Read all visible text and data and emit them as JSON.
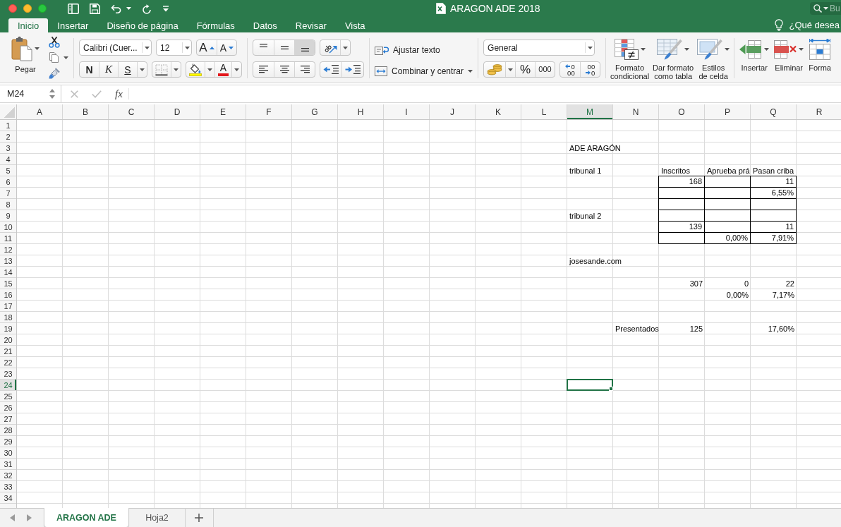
{
  "window": {
    "title": "ARAGON ADE 2018"
  },
  "search": {
    "placeholder": "Bu"
  },
  "ribbon_tabs": [
    {
      "label": "Inicio",
      "selected": true
    },
    {
      "label": "Insertar",
      "selected": false
    },
    {
      "label": "Diseño de página",
      "selected": false
    },
    {
      "label": "Fórmulas",
      "selected": false
    },
    {
      "label": "Datos",
      "selected": false
    },
    {
      "label": "Revisar",
      "selected": false
    },
    {
      "label": "Vista",
      "selected": false
    }
  ],
  "tell_me": {
    "placeholder": "¿Qué desea"
  },
  "ribbon": {
    "paste": {
      "label": "Pegar"
    },
    "font": {
      "name": "Calibri (Cuer...",
      "size": "12"
    },
    "font_size_buttons": [
      {
        "kind": "grow",
        "label": "A"
      },
      {
        "kind": "shrink",
        "label": "A"
      }
    ],
    "font_style_buttons": [
      {
        "kind": "bold",
        "label": "N"
      },
      {
        "kind": "italic",
        "label": "K"
      },
      {
        "kind": "underline",
        "label": "S"
      }
    ],
    "font_color": {
      "label": "A"
    },
    "vertical_align": [
      {
        "kind": "top",
        "selected": false
      },
      {
        "kind": "middle",
        "selected": false
      },
      {
        "kind": "bottom",
        "selected": true
      }
    ],
    "horizontal_align": [
      {
        "kind": "left",
        "selected": false
      },
      {
        "kind": "center",
        "selected": false
      },
      {
        "kind": "right",
        "selected": false
      }
    ],
    "wrap_text": {
      "label": "Ajustar texto"
    },
    "merge": {
      "label": "Combinar y centrar"
    },
    "number_format": {
      "value": "General"
    },
    "number_buttons": [
      {
        "kind": "percent",
        "label": "%"
      },
      {
        "kind": "thousands",
        "label": "000"
      }
    ],
    "decimal_buttons": [
      {
        "kind": "increase",
        "lines": [
          "0",
          "00"
        ]
      },
      {
        "kind": "decrease",
        "lines": [
          "00",
          "0"
        ]
      }
    ],
    "style_buttons": [
      {
        "kind": "conditional",
        "label": "Formato\ncondicional"
      },
      {
        "kind": "table",
        "label": "Dar formato\ncomo tabla"
      },
      {
        "kind": "cell_styles",
        "label": "Estilos\nde celda"
      }
    ],
    "cell_buttons": [
      {
        "kind": "insert",
        "label": "Insertar"
      },
      {
        "kind": "delete",
        "label": "Eliminar"
      },
      {
        "kind": "format",
        "label": "Forma"
      }
    ]
  },
  "formula_bar": {
    "name_box": "M24",
    "function_label": "fx"
  },
  "sheet": {
    "columns": [
      "A",
      "B",
      "C",
      "D",
      "E",
      "F",
      "G",
      "H",
      "I",
      "J",
      "K",
      "L",
      "M",
      "N",
      "O",
      "P",
      "Q",
      "R"
    ],
    "rows": [
      {
        "label": "1"
      },
      {
        "label": "2"
      },
      {
        "label": "3",
        "cells": {
          "M": {
            "text": "ADE ARAGÓN",
            "kind": "text",
            "bordered": false,
            "selected": false
          }
        }
      },
      {
        "label": "4"
      },
      {
        "label": "5",
        "cells": {
          "M": {
            "text": "tribunal 1",
            "kind": "text",
            "bordered": false,
            "selected": false
          },
          "O": {
            "text": "Inscritos",
            "kind": "text",
            "bordered": false,
            "selected": false
          },
          "P": {
            "text": "Aprueba prá",
            "kind": "text",
            "bordered": false,
            "selected": false
          },
          "Q": {
            "text": "Pasan criba",
            "kind": "text",
            "bordered": false,
            "selected": false
          }
        }
      },
      {
        "label": "6",
        "cells": {
          "O": {
            "text": "168",
            "kind": "number",
            "bordered": true,
            "selected": false
          },
          "P": {
            "bordered": true,
            "selected": false
          },
          "Q": {
            "text": "11",
            "kind": "number",
            "bordered": true,
            "selected": false
          }
        }
      },
      {
        "label": "7",
        "cells": {
          "O": {
            "bordered": true,
            "selected": false
          },
          "P": {
            "bordered": true,
            "selected": false
          },
          "Q": {
            "text": "6,55%",
            "kind": "number",
            "bordered": true,
            "selected": false
          }
        }
      },
      {
        "label": "8",
        "cells": {
          "O": {
            "bordered": true,
            "selected": false
          },
          "P": {
            "bordered": true,
            "selected": false
          },
          "Q": {
            "bordered": true,
            "selected": false
          }
        }
      },
      {
        "label": "9",
        "cells": {
          "M": {
            "text": "tribunal 2",
            "kind": "text",
            "bordered": false,
            "selected": false
          },
          "O": {
            "bordered": true,
            "selected": false
          },
          "P": {
            "bordered": true,
            "selected": false
          },
          "Q": {
            "bordered": true,
            "selected": false
          }
        }
      },
      {
        "label": "10",
        "cells": {
          "O": {
            "text": "139",
            "kind": "number",
            "bordered": true,
            "selected": false
          },
          "P": {
            "bordered": true,
            "selected": false
          },
          "Q": {
            "text": "11",
            "kind": "number",
            "bordered": true,
            "selected": false
          }
        }
      },
      {
        "label": "11",
        "cells": {
          "O": {
            "bordered": true,
            "selected": false
          },
          "P": {
            "text": "0,00%",
            "kind": "number",
            "bordered": true,
            "selected": false
          },
          "Q": {
            "text": "7,91%",
            "kind": "number",
            "bordered": true,
            "selected": false
          }
        }
      },
      {
        "label": "12"
      },
      {
        "label": "13",
        "cells": {
          "M": {
            "text": "josesande.com",
            "kind": "text",
            "bordered": false,
            "selected": false
          }
        }
      },
      {
        "label": "14"
      },
      {
        "label": "15",
        "cells": {
          "O": {
            "text": "307",
            "kind": "number",
            "bordered": false,
            "selected": false
          },
          "P": {
            "text": "0",
            "kind": "number",
            "bordered": false,
            "selected": false
          },
          "Q": {
            "text": "22",
            "kind": "number",
            "bordered": false,
            "selected": false
          }
        }
      },
      {
        "label": "16",
        "cells": {
          "P": {
            "text": "0,00%",
            "kind": "number",
            "bordered": false,
            "selected": false
          },
          "Q": {
            "text": "7,17%",
            "kind": "number",
            "bordered": false,
            "selected": false
          }
        }
      },
      {
        "label": "17"
      },
      {
        "label": "18"
      },
      {
        "label": "19",
        "cells": {
          "N": {
            "text": "Presentados",
            "kind": "text",
            "bordered": false,
            "selected": false
          },
          "O": {
            "text": "125",
            "kind": "number",
            "bordered": false,
            "selected": false
          },
          "Q": {
            "text": "17,60%",
            "kind": "number",
            "bordered": false,
            "selected": false
          }
        }
      },
      {
        "label": "20"
      },
      {
        "label": "21"
      },
      {
        "label": "22"
      },
      {
        "label": "23"
      },
      {
        "label": "24",
        "cells": {
          "M": {
            "bordered": false,
            "selected": true
          }
        }
      },
      {
        "label": "25"
      },
      {
        "label": "26"
      },
      {
        "label": "27"
      },
      {
        "label": "28"
      },
      {
        "label": "29"
      },
      {
        "label": "30"
      },
      {
        "label": "31"
      },
      {
        "label": "32"
      },
      {
        "label": "33"
      },
      {
        "label": "34"
      }
    ]
  },
  "sheet_tabs": [
    {
      "label": "ARAGON ADE",
      "selected": true
    },
    {
      "label": "Hoja2",
      "selected": false
    }
  ]
}
